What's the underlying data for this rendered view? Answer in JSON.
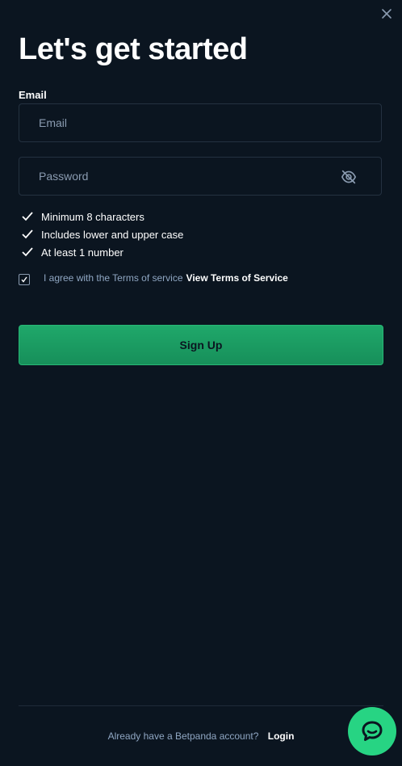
{
  "title": "Let's get started",
  "email": {
    "label": "Email",
    "placeholder": "Email",
    "value": ""
  },
  "password": {
    "placeholder": "Password",
    "value": ""
  },
  "rules": [
    "Minimum 8 characters",
    "Includes lower and upper case",
    "At least 1 number"
  ],
  "terms": {
    "checked": true,
    "text": "I agree with the Terms of service",
    "link": "View Terms of Service"
  },
  "signup_label": "Sign Up",
  "footer": {
    "question": "Already have a Betpanda account?",
    "login": "Login"
  },
  "colors": {
    "background": "#0b1520",
    "accent": "#1fa86a",
    "chat": "#27d483",
    "muted_text": "#8fa6c2"
  },
  "icons": [
    "close-icon",
    "eye-off-icon",
    "check-icon",
    "chat-icon"
  ]
}
